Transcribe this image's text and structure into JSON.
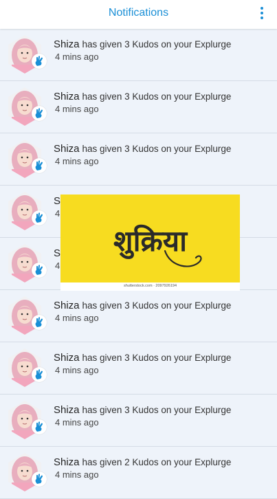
{
  "header": {
    "title": "Notifications",
    "menu_icon": "more-vertical-icon"
  },
  "colors": {
    "accent": "#1a8fd6",
    "row_bg": "#eef3fa",
    "banner_bg": "#f7dc20"
  },
  "notifications": [
    {
      "name": "Shiza",
      "message": "has given 3 Kudos on your Explurge",
      "time": "4 mins ago"
    },
    {
      "name": "Shiza",
      "message": "has given 3 Kudos on your Explurge",
      "time": "4 mins ago"
    },
    {
      "name": "Shiza",
      "message": "has given 3 Kudos on your Explurge",
      "time": "4 mins ago"
    },
    {
      "name": "Sl",
      "message": "",
      "time": "4"
    },
    {
      "name": "Sl",
      "message": "",
      "time": "4"
    },
    {
      "name": "Shiza",
      "message": "has given 3 Kudos on your Explurge",
      "time": "4 mins ago"
    },
    {
      "name": "Shiza",
      "message": "has given 3 Kudos on your Explurge",
      "time": "4 mins ago"
    },
    {
      "name": "Shiza",
      "message": "has given 3 Kudos on your Explurge",
      "time": "4 mins ago"
    },
    {
      "name": "Shiza",
      "message": "has given 2 Kudos on your Explurge",
      "time": "4 mins ago"
    }
  ],
  "overlay": {
    "text": "शुक्रिया",
    "credit": "shutterstock.com · 2097926194"
  }
}
